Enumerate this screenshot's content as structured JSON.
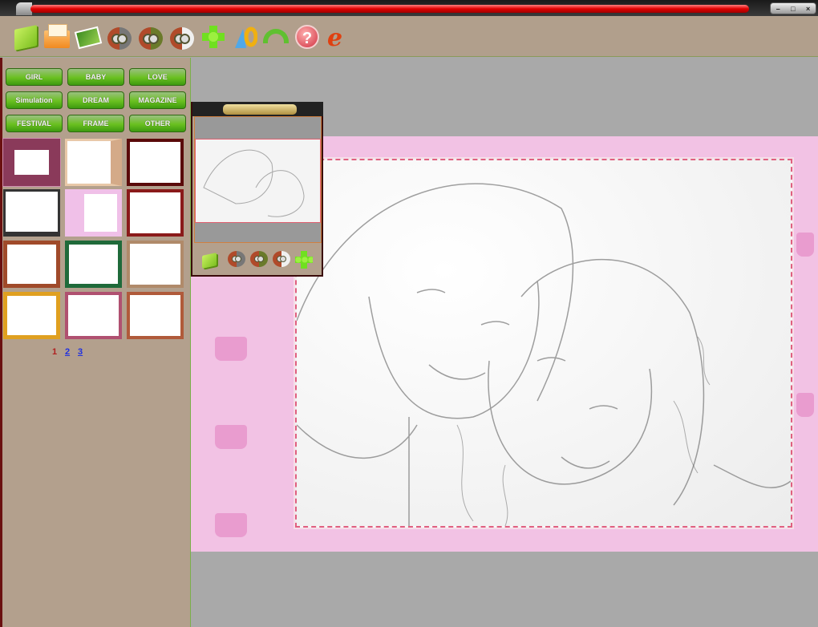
{
  "window": {
    "controls": [
      "–",
      "□",
      "×"
    ]
  },
  "toolbar": {
    "icons": [
      "open-folder-icon",
      "envelope-icon",
      "picture-edit-icon",
      "owl-gray-icon",
      "owl-green-icon",
      "owl-white-icon",
      "move-arrows-icon",
      "sort-icon",
      "undo-icon",
      "help-icon",
      "ie-icon"
    ],
    "help_glyph": "?",
    "ie_glyph": "e"
  },
  "categories": [
    "GIRL",
    "BABY",
    "LOVE",
    "Simulation",
    "DREAM",
    "MAGAZINE",
    "FESTIVAL",
    "FRAME",
    "OTHER"
  ],
  "pagination": {
    "pages": [
      "1",
      "2",
      "3"
    ],
    "current": "1",
    "current_color": "#b02020",
    "link_color": "#2030e0"
  },
  "colors": {
    "panel": "#b3a08d",
    "canvas": "#a9a9a9",
    "frame_pink": "#f2c2e4",
    "button_green": "#6ac020"
  }
}
